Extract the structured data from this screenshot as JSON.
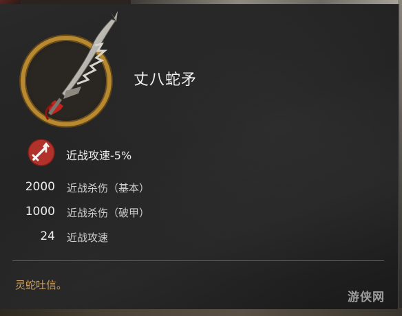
{
  "item": {
    "name": "丈八蛇矛",
    "effect": "近战攻速-5%",
    "stats": [
      {
        "value": "2000",
        "label": "近战杀伤（基本）"
      },
      {
        "value": "1000",
        "label": "近战杀伤（破甲）"
      },
      {
        "value": "24",
        "label": "近战攻速"
      }
    ],
    "flavor": "灵蛇吐信。"
  },
  "watermark": "游侠网",
  "colors": {
    "ring_gold": "#b8892e",
    "effect_red": "#b1312b",
    "flavor_gold": "#c8a063"
  },
  "icons": {
    "weapon": "serpent-spear-icon",
    "effect": "attack-speed-down-icon"
  }
}
